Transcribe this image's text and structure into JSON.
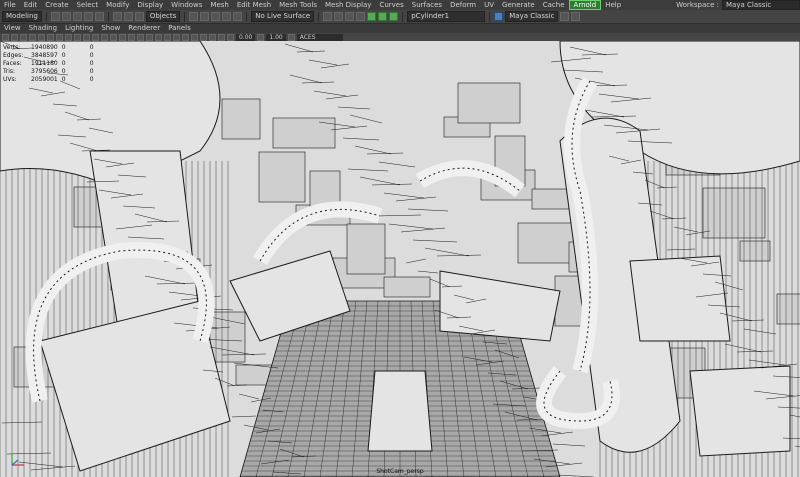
{
  "menubar": {
    "items": [
      "File",
      "Edit",
      "Create",
      "Select",
      "Modify",
      "Display",
      "Windows",
      "Mesh",
      "Edit Mesh",
      "Mesh Tools",
      "Mesh Display",
      "Curves",
      "Surfaces",
      "Deform",
      "UV",
      "Generate",
      "Cache",
      "Arnold",
      "Help"
    ],
    "active": "Arnold",
    "workspace_label": "Workspace :",
    "workspace_value": "Maya Classic"
  },
  "shelf": {
    "mode_dropdown": "Modeling",
    "objects_dropdown": "Objects",
    "symmetry_label": "No Live Surface",
    "name_field": "pCylinder1",
    "tab_label": "Maya Classic"
  },
  "panel_menu": [
    "View",
    "Shading",
    "Lighting",
    "Show",
    "Renderer",
    "Panels"
  ],
  "viewport_toolbar": {
    "value_a": "0.00",
    "value_b": "1.00",
    "color_space": "ACES"
  },
  "hud": {
    "rows": [
      [
        "Verts:",
        "1940890",
        "0",
        "0"
      ],
      [
        "Edges:",
        "3848597",
        "0",
        "0"
      ],
      [
        "Faces:",
        "1911180",
        "0",
        "0"
      ],
      [
        "Tris:",
        "3795606",
        "0",
        "0"
      ],
      [
        "UVs:",
        "2059001",
        "0",
        "0"
      ]
    ]
  },
  "camera_name": "ShotCam_persp",
  "colors": {
    "accent_green": "#2e7d32",
    "wire": "#1a1a1a",
    "viewport_bg": "#dcdcdc"
  }
}
